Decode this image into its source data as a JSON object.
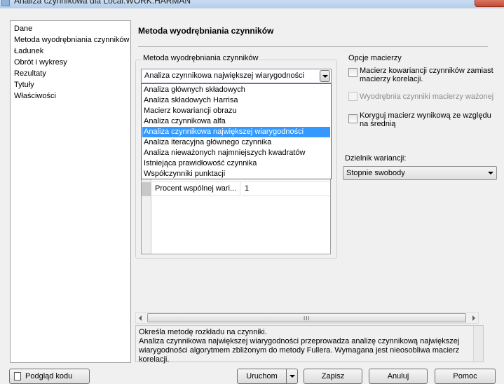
{
  "window": {
    "title": "Analiza czynnikowa dla Local.WORK.HARMAN"
  },
  "nav": {
    "items": [
      {
        "label": "Dane"
      },
      {
        "label": "Metoda wyodrębniania czynników"
      },
      {
        "label": "Ładunek"
      },
      {
        "label": "Obrót i wykresy"
      },
      {
        "label": "Rezultaty"
      },
      {
        "label": "Tytuły"
      },
      {
        "label": "Właściwości"
      }
    ]
  },
  "main": {
    "title": "Metoda wyodrębniania czynników",
    "method_group": {
      "label": "Metoda wyodrębniania czynników",
      "selected": "Analiza czynnikowa największej wiarygodności",
      "options": [
        "Analiza głównych składowych",
        "Analiza składowych Harrisa",
        "Macierz kowariancji obrazu",
        "Analiza czynnikowa alfa",
        "Analiza czynnikowa największej wiarygodności",
        "Analiza iteracyjna głównego czynnika",
        "Analiza nieważonych najmniejszych kwadratów",
        "Istniejąca prawidłowość czynnika",
        "Współczynniki punktacji"
      ],
      "selected_index": 4
    },
    "grid": {
      "row_name": "Procent wspólnej wari...",
      "row_value": "1"
    },
    "opcje": {
      "label": "Opcje macierzy",
      "checkboxes": [
        {
          "label_line1": "Macierz kowariancji czynników zamiast",
          "label_line2": "macierzy korelacji.",
          "checked": false,
          "enabled": true
        },
        {
          "label_line1": "Wyodrębnia czynniki macierzy ważonej",
          "label_line2": "",
          "checked": false,
          "enabled": false
        },
        {
          "label_line1": "Koryguj macierz wynikową ze względu",
          "label_line2": "na średnią",
          "checked": false,
          "enabled": true
        }
      ]
    },
    "dzielnik": {
      "label": "Dzielnik wariancji:",
      "value": "Stopnie swobody"
    },
    "scrollbar": {
      "grip": "III"
    },
    "description": {
      "line1": "Określa metodę rozkładu na czynniki.",
      "line2": "Analiza czynnikowa największej wiarygodności przeprowadza analizę czynnikową największej",
      "line3": "wiarygodności algorytmem zbliżonym do metody Fullera. Wymagana jest nieosobliwa macierz korelacji."
    }
  },
  "buttons": {
    "podglad": "Podgląd kodu",
    "uruchom": "Uruchom",
    "zapisz": "Zapisz",
    "anuluj": "Anuluj",
    "pomoc": "Pomoc"
  }
}
